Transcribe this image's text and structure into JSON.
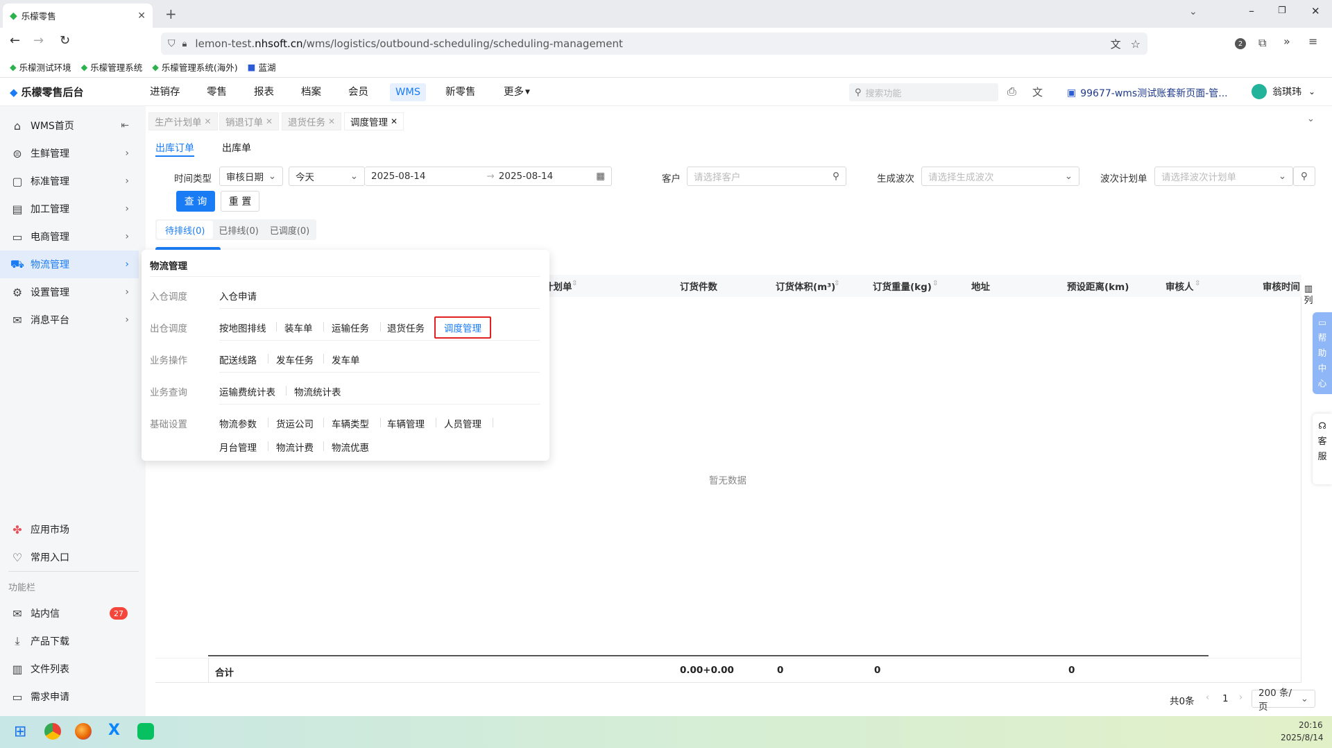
{
  "browser": {
    "tab_title": "乐檬零售",
    "url_prefix": "lemon-test.",
    "url_domain": "nhsoft.cn",
    "url_path": "/wms/logistics/outbound-scheduling/scheduling-management",
    "ext_badge": "2"
  },
  "bookmarks": [
    {
      "label": "乐檬测试环境"
    },
    {
      "label": "乐檬管理系统"
    },
    {
      "label": "乐檬管理系统(海外)"
    },
    {
      "label": "蓝湖"
    }
  ],
  "app": {
    "brand": "乐檬零售后台",
    "nav": [
      "进销存",
      "零售",
      "报表",
      "档案",
      "会员",
      "WMS",
      "新零售",
      "更多"
    ],
    "active_nav": "WMS",
    "search_placeholder": "搜索功能",
    "account": "99677-wms测试账套新页面-管...",
    "user": "翁琪玮"
  },
  "sidebar": {
    "items": [
      {
        "label": "WMS首页",
        "icon": "home-icon"
      },
      {
        "label": "生鲜管理",
        "icon": "fresh-icon"
      },
      {
        "label": "标准管理",
        "icon": "standard-icon"
      },
      {
        "label": "加工管理",
        "icon": "process-icon"
      },
      {
        "label": "电商管理",
        "icon": "shop-icon"
      },
      {
        "label": "物流管理",
        "icon": "logistics-icon"
      },
      {
        "label": "设置管理",
        "icon": "settings-icon"
      },
      {
        "label": "消息平台",
        "icon": "message-icon"
      }
    ],
    "active": "物流管理",
    "bottom": [
      {
        "label": "应用市场"
      },
      {
        "label": "常用入口"
      }
    ],
    "section": "功能栏",
    "func": [
      {
        "label": "站内信",
        "badge": "27"
      },
      {
        "label": "产品下载"
      },
      {
        "label": "文件列表"
      },
      {
        "label": "需求申请"
      }
    ]
  },
  "page_tabs": [
    "生产计划单",
    "销退订单",
    "退货任务",
    "调度管理"
  ],
  "sub_tabs": [
    "出库订单",
    "出库单"
  ],
  "filters": {
    "time_type_label": "时间类型",
    "time_type": "审核日期",
    "range": "今天",
    "date_from": "2025-08-14",
    "date_to": "2025-08-14",
    "customer_label": "客户",
    "customer_ph": "请选择客户",
    "wave_label": "生成波次",
    "wave_ph": "请选择生成波次",
    "plan_label": "波次计划单",
    "plan_ph": "请选择波次计划单",
    "query": "查 询",
    "reset": "重 置"
  },
  "status_tabs": [
    "待排线(0)",
    "已排线(0)",
    "已调度(0)"
  ],
  "table": {
    "headers": [
      "计划单",
      "订货件数",
      "订货体积(m³)",
      "订货重量(kg)",
      "地址",
      "预设距离(km)",
      "审核人",
      "审核时间"
    ],
    "col_setting": "列",
    "empty": "暂无数据",
    "sum_label": "合计",
    "sums": [
      "0.00+0.00",
      "0",
      "0",
      "0"
    ]
  },
  "pagination": {
    "total": "共0条",
    "page": "1",
    "size": "200 条/页"
  },
  "side_help": {
    "help": [
      "帮",
      "助",
      "中",
      "心"
    ],
    "service": [
      "客",
      "服"
    ]
  },
  "menu": {
    "title": "物流管理",
    "rows": [
      {
        "cat": "入仓调度",
        "items": [
          "入仓申请"
        ]
      },
      {
        "cat": "出仓调度",
        "items": [
          "按地图排线",
          "装车单",
          "运输任务",
          "退货任务",
          "调度管理"
        ]
      },
      {
        "cat": "业务操作",
        "items": [
          "配送线路",
          "发车任务",
          "发车单"
        ]
      },
      {
        "cat": "业务查询",
        "items": [
          "运输费统计表",
          "物流统计表"
        ]
      },
      {
        "cat": "基础设置",
        "items": [
          "物流参数",
          "货运公司",
          "车辆类型",
          "车辆管理",
          "人员管理",
          "月台管理",
          "物流计费",
          "物流优惠"
        ]
      }
    ],
    "highlight": "调度管理"
  },
  "taskbar": {
    "time": "20:16",
    "date": "2025/8/14"
  },
  "colors": {
    "primary": "#1a7cf5",
    "highlight_border": "#e02020",
    "badge": "#f5463c"
  }
}
